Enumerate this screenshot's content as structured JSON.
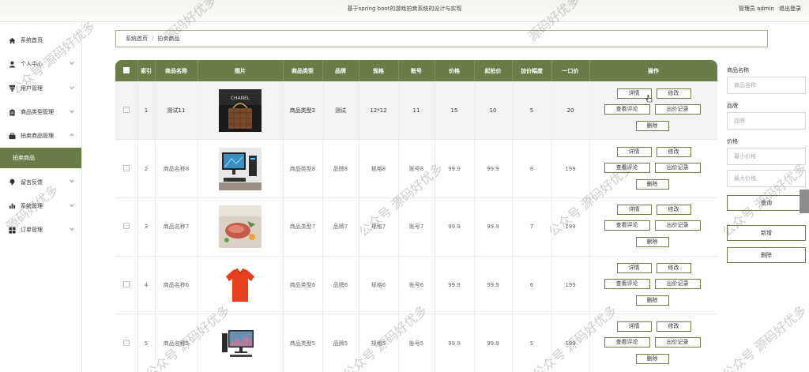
{
  "header": {
    "title": "基于spring boot的游戏拍卖系统的设计与实现",
    "user": "管理员 admin",
    "logout": "退出登录"
  },
  "sidebar": {
    "items": [
      {
        "label": "系统首页",
        "icon": "home-icon"
      },
      {
        "label": "个人中心",
        "icon": "person-icon"
      },
      {
        "label": "用户管理",
        "icon": "user-manage-icon"
      },
      {
        "label": "商品类型管理",
        "icon": "clipboard-icon"
      },
      {
        "label": "拍卖商品管理",
        "icon": "auction-icon"
      },
      {
        "label": "留言反馈",
        "icon": "pin-icon"
      },
      {
        "label": "系统管理",
        "icon": "bar-chart-icon"
      },
      {
        "label": "订单管理",
        "icon": "grid-icon"
      }
    ],
    "submenu": "拍卖商品"
  },
  "breadcrumb": {
    "home": "系统首页",
    "sep": "/",
    "current": "拍卖商品"
  },
  "table": {
    "headers": [
      "",
      "索引",
      "商品名称",
      "图片",
      "商品类型",
      "品牌",
      "规格",
      "账号",
      "价格",
      "起拍价",
      "加价幅度",
      "一口价",
      "操作"
    ],
    "rows": [
      {
        "index": "1",
        "name": "测试11",
        "type": "商品类型2",
        "brand": "测试",
        "spec": "12*12",
        "account": "11",
        "price": "15",
        "start": "10",
        "step": "5",
        "buyout": "20"
      },
      {
        "index": "2",
        "name": "商品名称8",
        "type": "商品类型8",
        "brand": "品牌8",
        "spec": "规格8",
        "account": "账号8",
        "price": "99.9",
        "start": "99.9",
        "step": "8",
        "buyout": "199"
      },
      {
        "index": "3",
        "name": "商品名称7",
        "type": "商品类型7",
        "brand": "品牌7",
        "spec": "规格7",
        "account": "账号7",
        "price": "99.9",
        "start": "99.9",
        "step": "7",
        "buyout": "199"
      },
      {
        "index": "4",
        "name": "商品名称6",
        "type": "商品类型6",
        "brand": "品牌6",
        "spec": "规格6",
        "account": "账号6",
        "price": "99.9",
        "start": "99.9",
        "step": "6",
        "buyout": "199"
      },
      {
        "index": "5",
        "name": "商品名称5",
        "type": "商品类型5",
        "brand": "品牌5",
        "spec": "规格5",
        "account": "账号5",
        "price": "99.9",
        "start": "99.9",
        "step": "5",
        "buyout": "199"
      }
    ],
    "actions": {
      "detail": "详情",
      "edit": "修改",
      "reviews": "查看评论",
      "bids": "出价记录",
      "delete": "删除"
    }
  },
  "search": {
    "name_label": "商品名称",
    "name_placeholder": "商品名称",
    "brand_label": "品牌",
    "brand_placeholder": "品牌",
    "price_label": "价格",
    "min_placeholder": "最小价格",
    "max_placeholder": "最大价格",
    "query": "查询",
    "add": "新增",
    "delete": "删除"
  },
  "watermark": {
    "text1": "公众号 源码好优多",
    "text2": "源码好优多"
  },
  "colors": {
    "accent": "#6a7d47",
    "row_highlight": "#f3f3f6"
  }
}
